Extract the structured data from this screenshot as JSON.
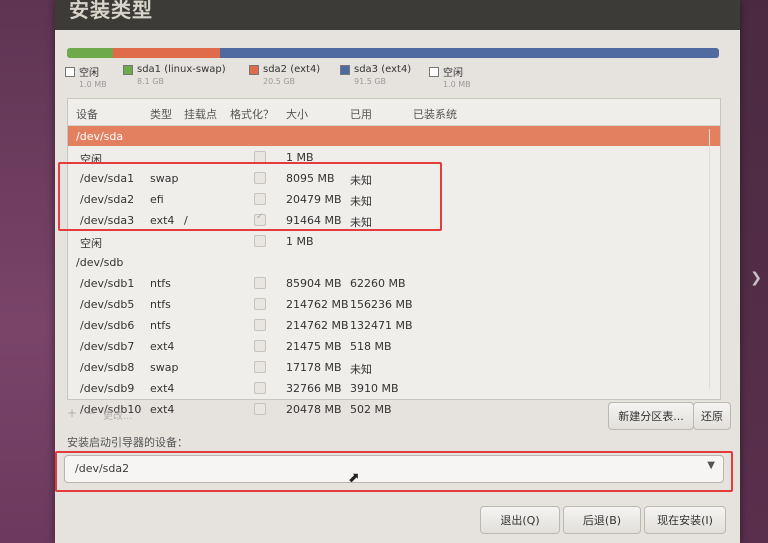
{
  "window": {
    "title": "安装类型"
  },
  "usage_bar": {
    "segments": [
      {
        "name": "空闲",
        "color": "#ffffff",
        "fraction": 0.0
      },
      {
        "name": "sda1 (linux-swap)",
        "color": "#6ea94b",
        "fraction": 0.07
      },
      {
        "name": "sda2 (ext4)",
        "color": "#e06b4b",
        "fraction": 0.165
      },
      {
        "name": "sda3 (ext4)",
        "color": "#4f6aa0",
        "fraction": 0.765
      }
    ]
  },
  "legend": [
    {
      "label": "空闲",
      "size": "1.0 MB",
      "color": "#ffffff"
    },
    {
      "label": "sda1 (linux-swap)",
      "size": "8.1 GB",
      "color": "#6ea94b"
    },
    {
      "label": "sda2 (ext4)",
      "size": "20.5 GB",
      "color": "#e06b4b"
    },
    {
      "label": "sda3 (ext4)",
      "size": "91.5 GB",
      "color": "#4f6aa0"
    },
    {
      "label": "空闲",
      "size": "1.0 MB",
      "color": "#ffffff"
    }
  ],
  "table": {
    "headers": [
      "设备",
      "类型",
      "挂载点",
      "格式化？",
      "大小",
      "已用",
      "已装系统"
    ],
    "rows": [
      {
        "device": "/dev/sda",
        "type": "",
        "mount": "",
        "format": false,
        "show_check": false,
        "size": "",
        "used": ""
      },
      {
        "device": "空闲",
        "type": "",
        "mount": "",
        "format": false,
        "show_check": true,
        "size": "1 MB",
        "used": ""
      },
      {
        "device": "/dev/sda1",
        "type": "swap",
        "mount": "",
        "format": false,
        "show_check": true,
        "size": "8095 MB",
        "used": "未知"
      },
      {
        "device": "/dev/sda2",
        "type": "efi",
        "mount": "",
        "format": false,
        "show_check": true,
        "size": "20479 MB",
        "used": "未知"
      },
      {
        "device": "/dev/sda3",
        "type": "ext4",
        "mount": "/",
        "format": true,
        "show_check": true,
        "size": "91464 MB",
        "used": "未知"
      },
      {
        "device": "空闲",
        "type": "",
        "mount": "",
        "format": false,
        "show_check": true,
        "size": "1 MB",
        "used": ""
      },
      {
        "device": "/dev/sdb",
        "type": "",
        "mount": "",
        "format": false,
        "show_check": false,
        "size": "",
        "used": ""
      },
      {
        "device": "/dev/sdb1",
        "type": "ntfs",
        "mount": "",
        "format": false,
        "show_check": true,
        "size": "85904 MB",
        "used": "62260 MB"
      },
      {
        "device": "/dev/sdb5",
        "type": "ntfs",
        "mount": "",
        "format": false,
        "show_check": true,
        "size": "214762 MB",
        "used": "156236 MB"
      },
      {
        "device": "/dev/sdb6",
        "type": "ntfs",
        "mount": "",
        "format": false,
        "show_check": true,
        "size": "214762 MB",
        "used": "132471 MB"
      },
      {
        "device": "/dev/sdb7",
        "type": "ext4",
        "mount": "",
        "format": false,
        "show_check": true,
        "size": "21475 MB",
        "used": "518 MB"
      },
      {
        "device": "/dev/sdb8",
        "type": "swap",
        "mount": "",
        "format": false,
        "show_check": true,
        "size": "17178 MB",
        "used": "未知"
      },
      {
        "device": "/dev/sdb9",
        "type": "ext4",
        "mount": "",
        "format": false,
        "show_check": true,
        "size": "32766 MB",
        "used": "3910 MB"
      },
      {
        "device": "/dev/sdb10",
        "type": "ext4",
        "mount": "",
        "format": false,
        "show_check": true,
        "size": "20478 MB",
        "used": "502 MB"
      }
    ]
  },
  "toolbar": {
    "add_label": "+",
    "remove_label": "−",
    "change_label": "更改...",
    "new_table_label": "新建分区表...",
    "revert_label": "还原"
  },
  "boot": {
    "label": "安装启动引导器的设备：",
    "value": "/dev/sda2"
  },
  "footer": {
    "quit_label": "退出(Q)",
    "back_label": "后退(B)",
    "install_label": "现在安装(I)"
  },
  "colors": {
    "selected_row": "#e3805f",
    "highlight_box": "#e23c3c"
  }
}
